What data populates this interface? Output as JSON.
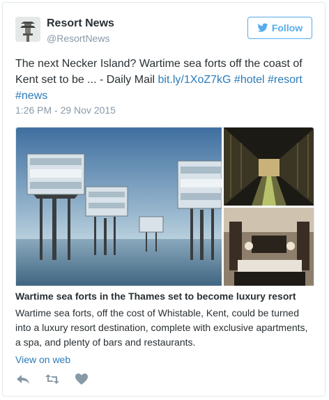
{
  "author": {
    "name": "Resort News",
    "handle": "@ResortNews"
  },
  "follow_label": "Follow",
  "tweet": {
    "text": "The next Necker Island? Wartime sea forts off the coast of Kent set to be ... - Daily Mail ",
    "link": "bit.ly/1XoZ7kG",
    "hashtags": [
      "#hotel",
      "#resort",
      "#news"
    ],
    "timestamp": "1:26 PM - 29 Nov 2015"
  },
  "card": {
    "title": "Wartime sea forts in the Thames set to become luxury resort",
    "description": "Wartime sea forts, off the cost of Whistable, Kent, could be turned into a luxury resort destination, complete with exclusive apartments, a spa, and plenty of bars and restaurants.",
    "view_on_web": "View on web"
  },
  "icons": {
    "avatar": "pagoda-icon",
    "follow": "bird-icon",
    "reply": "reply-icon",
    "retweet": "retweet-icon",
    "like": "heart-icon"
  },
  "colors": {
    "accent": "#55acee",
    "link": "#2b7bb9",
    "muted": "#8899a6",
    "icon": "#8899a6"
  }
}
